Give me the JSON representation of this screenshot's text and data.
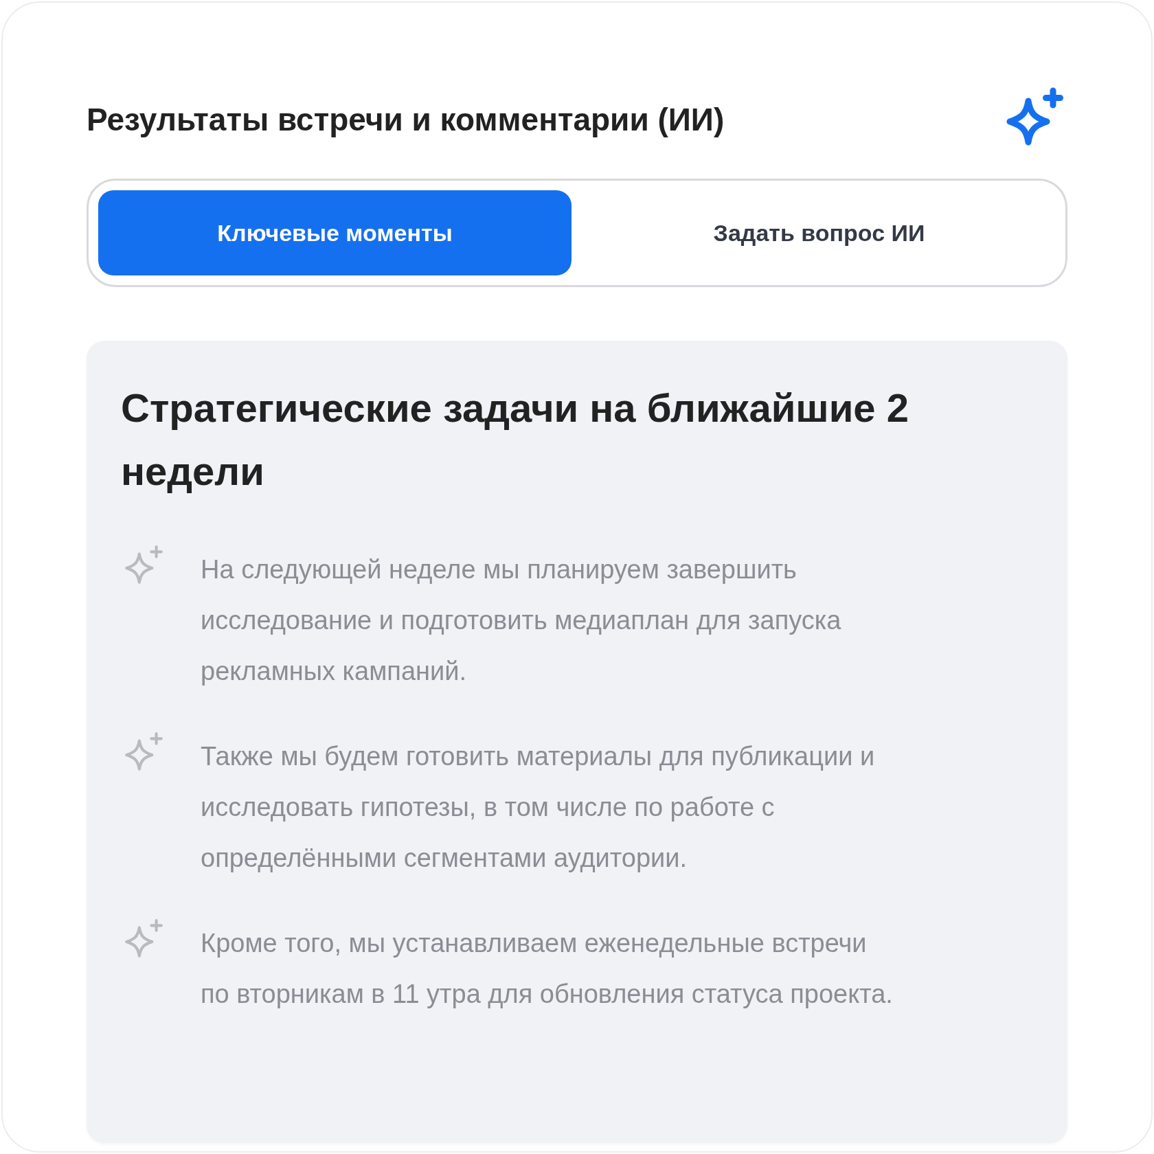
{
  "header": {
    "title": "Результаты встречи и комментарии (ИИ)"
  },
  "tabs": [
    {
      "label": "Ключевые моменты",
      "selected": true
    },
    {
      "label": "Задать вопрос ИИ",
      "selected": false
    }
  ],
  "panel": {
    "heading": "Стратегические задачи на ближайшие 2 недели",
    "items": [
      {
        "text": "На следующей неделе мы планируем завершить исследование и подготовить медиаплан для запуска рекламных кампаний."
      },
      {
        "text": "Также мы будем готовить материалы для публикации и исследовать гипотезы, в том числе по работе с определёнными сегментами аудитории."
      },
      {
        "text": "Кроме того, мы устанавливаем еженедельные встречи по вторникам в 11 утра для обновления статуса проекта."
      }
    ]
  }
}
